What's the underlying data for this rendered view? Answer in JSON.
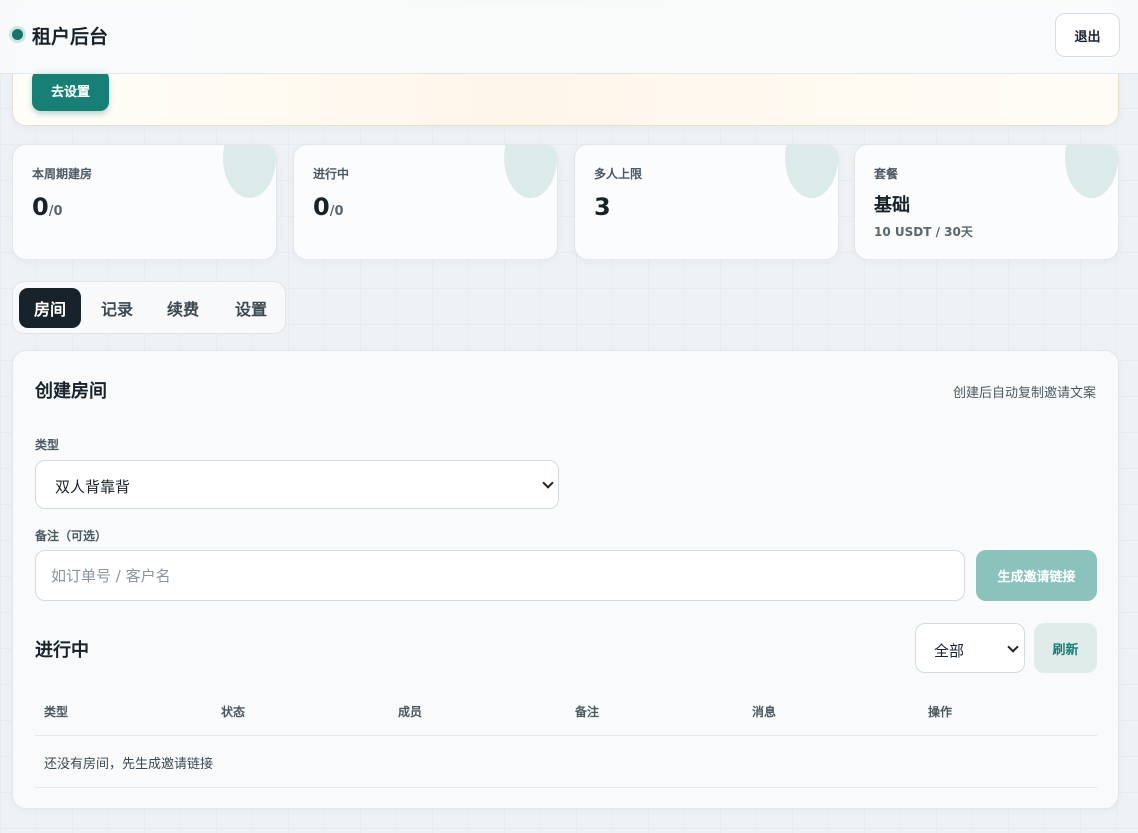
{
  "header": {
    "title": "租户后台",
    "logout_label": "退出"
  },
  "banner": {
    "button_label": "去设置"
  },
  "stats": [
    {
      "label": "本周期建房",
      "value": "0",
      "suffix": "/0"
    },
    {
      "label": "进行中",
      "value": "0",
      "suffix": "/0"
    },
    {
      "label": "多人上限",
      "value": "3"
    },
    {
      "label": "套餐",
      "value": "基础",
      "sub": "10 USDT / 30天"
    }
  ],
  "tabs": [
    "房间",
    "记录",
    "续费",
    "设置"
  ],
  "create": {
    "title": "创建房间",
    "hint": "创建后自动复制邀请文案",
    "type_label": "类型",
    "type_value": "双人背靠背",
    "note_label": "备注（可选）",
    "note_placeholder": "如订单号 / 客户名",
    "generate_label": "生成邀请链接"
  },
  "active": {
    "title": "进行中",
    "filter_value": "全部",
    "refresh_label": "刷新",
    "columns": [
      "类型",
      "状态",
      "成员",
      "备注",
      "消息",
      "操作"
    ],
    "empty_text": "还没有房间，先生成邀请链接"
  },
  "colors": {
    "accent": "#187f76",
    "dark": "#17222b",
    "accent_light": "#8ac2bc"
  }
}
